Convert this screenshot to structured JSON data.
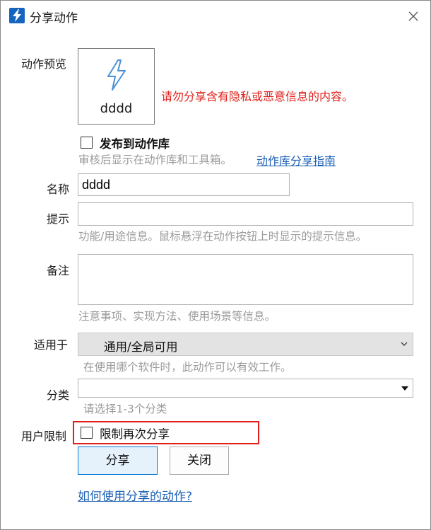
{
  "window": {
    "title": "分享动作",
    "app_icon": "bolt-icon",
    "close_icon": "close-icon"
  },
  "preview": {
    "label": "动作预览",
    "action_name": "dddd",
    "icon": "bolt-icon",
    "warning": "请勿分享含有隐私或恶意信息的内容。"
  },
  "publish": {
    "checkbox_label": "发布到动作库",
    "checked": false,
    "hint": "审核后显示在动作库和工具箱。",
    "guide_link": "动作库分享指南"
  },
  "name_field": {
    "label": "名称",
    "value": "dddd"
  },
  "tip_field": {
    "label": "提示",
    "value": "",
    "hint": "功能/用途信息。鼠标悬浮在动作按钮上时显示的提示信息。"
  },
  "note_field": {
    "label": "备注",
    "value": "",
    "hint": "注意事项、实现方法、使用场景等信息。"
  },
  "applies_to": {
    "label": "适用于",
    "selected": "通用/全局可用",
    "hint": "在使用哪个软件时，此动作可以有效工作。"
  },
  "category": {
    "label": "分类",
    "selected": "",
    "hint": "请选择1-3个分类"
  },
  "user_limit": {
    "label": "用户限制",
    "checkbox_label": "限制再次分享",
    "checked": false,
    "highlight_color": "#e0211b"
  },
  "buttons": {
    "share": "分享",
    "close": "关闭"
  },
  "help_link": "如何使用分享的动作?",
  "colors": {
    "accent": "#0078d7",
    "link": "#1a5fb4",
    "warning": "#e0211b",
    "hint": "#9a9a9a"
  }
}
